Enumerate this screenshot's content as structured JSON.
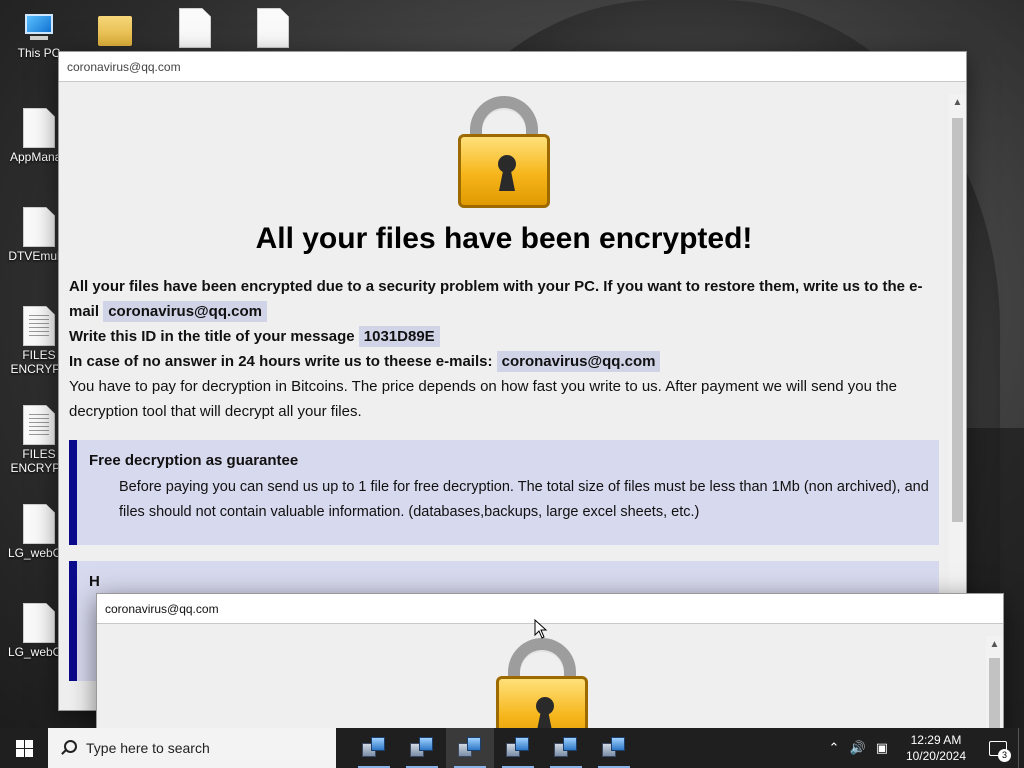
{
  "desktop": {
    "icons": [
      {
        "label": "This PC",
        "icon": "this-pc-icon"
      },
      {
        "label": "",
        "icon": "folder-icon"
      },
      {
        "label": "",
        "icon": "file-icon"
      },
      {
        "label": "",
        "icon": "file-icon"
      },
      {
        "label": "AppManag",
        "icon": "file-icon"
      },
      {
        "label": "DTVEmulat",
        "icon": "file-icon"
      },
      {
        "label": "FILES ENCRYPT",
        "icon": "text-file-icon"
      },
      {
        "label": "FILES ENCRYPT",
        "icon": "text-file-icon"
      },
      {
        "label": "LG_webOS",
        "icon": "file-icon"
      },
      {
        "label": "LG_webOS",
        "icon": "file-icon"
      }
    ]
  },
  "window_main": {
    "title": "coronavirus@qq.com",
    "heading": "All your files have been encrypted!",
    "line1": "All your files have been encrypted due to a security problem with your PC. If you want to restore them, write us to the e-mail",
    "email": "coronavirus@qq.com",
    "line2": "Write this ID in the title of your message",
    "id": "1031D89E",
    "line3": "In case of no answer in 24 hours write us to theese e-mails:",
    "email2": "coronavirus@qq.com",
    "line4": "You have to pay for decryption in Bitcoins. The price depends on how fast you write to us. After payment we will send you the decryption tool that will decrypt all your files.",
    "note1_title": "Free decryption as guarantee",
    "note1_body": "Before paying you can send us up to 1 file for free decryption. The total size of files must be less than 1Mb (non archived), and files should not contain valuable information. (databases,backups, large excel sheets, etc.)",
    "note2_title": "H"
  },
  "window_second": {
    "title": "coronavirus@qq.com"
  },
  "taskbar": {
    "search_placeholder": "Type here to search",
    "apps_count": 6,
    "time": "12:29 AM",
    "date": "10/20/2024",
    "notification_count": "3"
  },
  "colors": {
    "note_bg": "#d7d9ee",
    "note_border": "#0a0a8a",
    "highlight_bg": "#d0d4e6",
    "lock_gold": "#f6b61b",
    "taskbar": "#1f1f1f"
  }
}
